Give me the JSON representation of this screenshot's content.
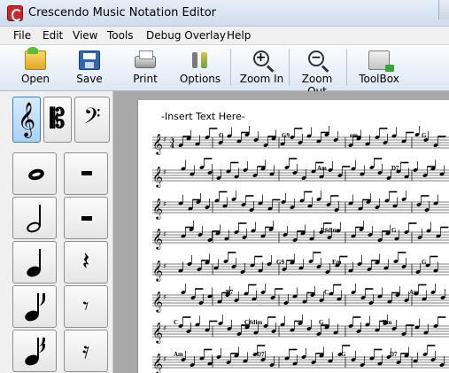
{
  "window": {
    "title": "Crescendo Music Notation Editor"
  },
  "menu": [
    "File",
    "Edit",
    "View",
    "Tools",
    "Debug Overlay",
    "Help"
  ],
  "toolbar": {
    "open": "Open",
    "save": "Save",
    "print": "Print",
    "options": "Options",
    "zoom_in": "Zoom In",
    "zoom_out": "Zoom Out",
    "toolbox": "ToolBox"
  },
  "palette": {
    "clefs": [
      "treble-clef",
      "alto-clef",
      "bass-clef"
    ],
    "selected_clef": "treble-clef",
    "notes": [
      "whole-note",
      "half-note",
      "quarter-note",
      "eighth-note",
      "sixteenth-note"
    ],
    "rests": [
      "whole-rest",
      "half-rest",
      "quarter-rest",
      "eighth-rest",
      "sixteenth-rest"
    ]
  },
  "score": {
    "insert_text": "-Insert Text Here-",
    "chords": [
      [
        "G",
        "G9",
        "em",
        "G"
      ],
      [
        "Am",
        "D7"
      ],
      [],
      [
        "F♯dim",
        "G"
      ],
      [
        "G9",
        "Em",
        "G"
      ],
      [
        "B7",
        "C",
        "Am"
      ],
      [
        "C",
        "C♯dim",
        "G",
        "Em"
      ],
      [
        "Am",
        "D7",
        "G",
        "D7"
      ]
    ],
    "time_signature": "3/4",
    "key_signature": "G major (1 sharp)"
  },
  "colors": {
    "workspace": "#a8a8a8",
    "selected_button": "#a9d2f2"
  }
}
